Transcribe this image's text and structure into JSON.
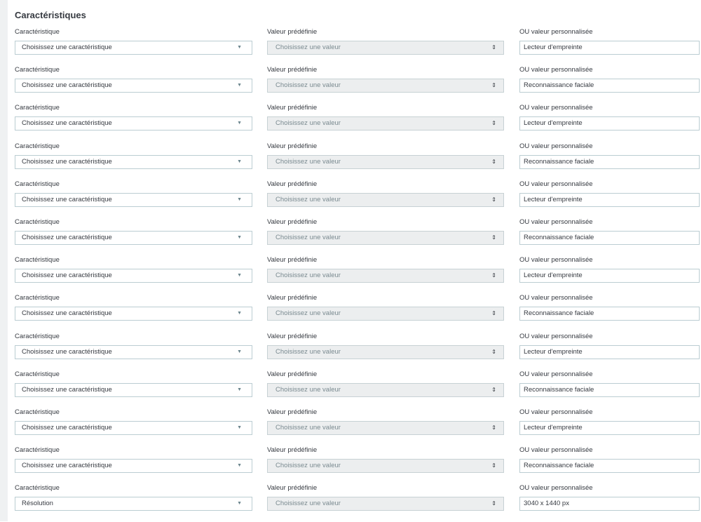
{
  "section_title": "Caractéristiques",
  "labels": {
    "feature": "Caractéristique",
    "predefined": "Valeur prédéfinie",
    "custom": "OU valeur personnalisée"
  },
  "rows": [
    {
      "feature": "Choisissez une caractéristique",
      "predefined": "Choisissez une valeur",
      "custom": "Lecteur d'empreinte"
    },
    {
      "feature": "Choisissez une caractéristique",
      "predefined": "Choisissez une valeur",
      "custom": "Reconnaissance faciale"
    },
    {
      "feature": "Choisissez une caractéristique",
      "predefined": "Choisissez une valeur",
      "custom": "Lecteur d'empreinte"
    },
    {
      "feature": "Choisissez une caractéristique",
      "predefined": "Choisissez une valeur",
      "custom": "Reconnaissance faciale"
    },
    {
      "feature": "Choisissez une caractéristique",
      "predefined": "Choisissez une valeur",
      "custom": "Lecteur d'empreinte"
    },
    {
      "feature": "Choisissez une caractéristique",
      "predefined": "Choisissez une valeur",
      "custom": "Reconnaissance faciale"
    },
    {
      "feature": "Choisissez une caractéristique",
      "predefined": "Choisissez une valeur",
      "custom": "Lecteur d'empreinte"
    },
    {
      "feature": "Choisissez une caractéristique",
      "predefined": "Choisissez une valeur",
      "custom": "Reconnaissance faciale"
    },
    {
      "feature": "Choisissez une caractéristique",
      "predefined": "Choisissez une valeur",
      "custom": "Lecteur d'empreinte"
    },
    {
      "feature": "Choisissez une caractéristique",
      "predefined": "Choisissez une valeur",
      "custom": "Reconnaissance faciale"
    },
    {
      "feature": "Choisissez une caractéristique",
      "predefined": "Choisissez une valeur",
      "custom": "Lecteur d'empreinte"
    },
    {
      "feature": "Choisissez une caractéristique",
      "predefined": "Choisissez une valeur",
      "custom": "Reconnaissance faciale"
    },
    {
      "feature": "Résolution",
      "predefined": "Choisissez une valeur",
      "custom": "3040 x 1440 px"
    }
  ],
  "icons": {
    "dropdown": "chevron-down-icon",
    "spinner": "up-down-arrows-icon"
  },
  "colors": {
    "border": "#bbcdd2",
    "disabled_bg": "#eceeef",
    "text": "#363a41"
  }
}
